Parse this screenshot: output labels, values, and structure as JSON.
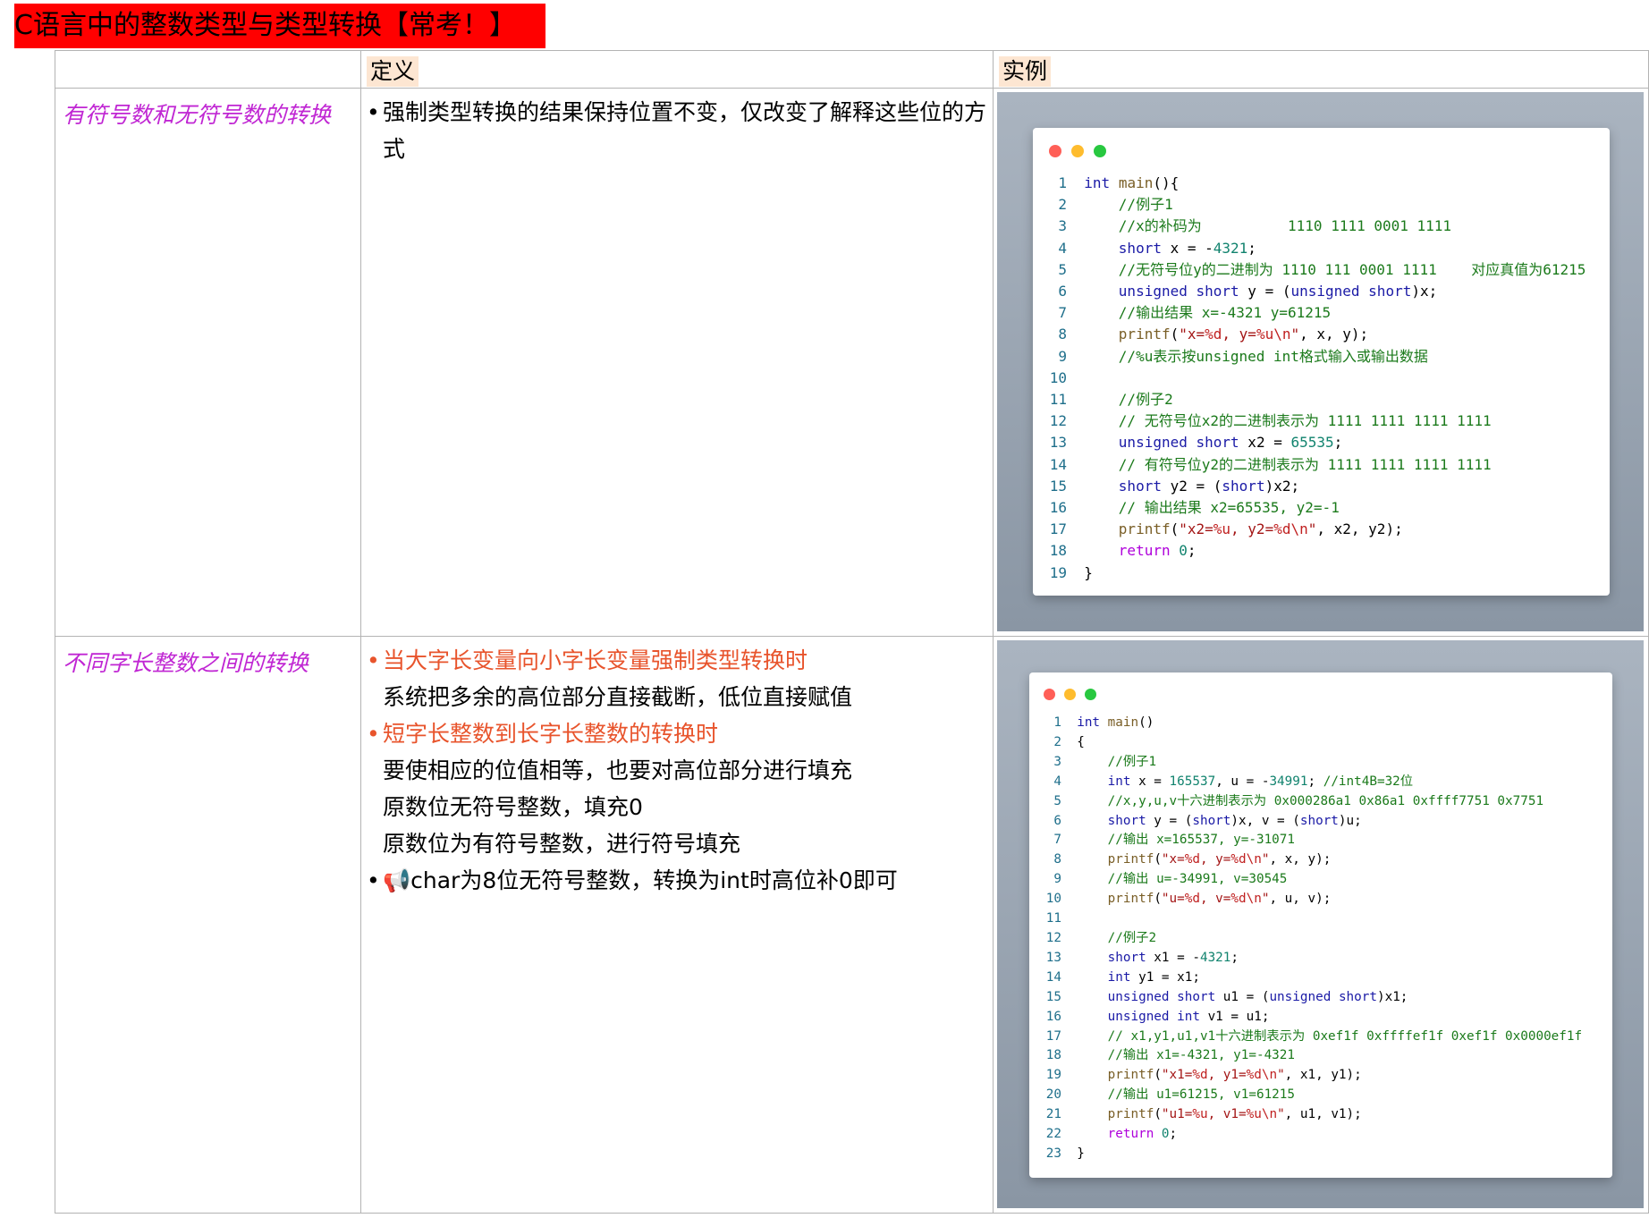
{
  "title": "C语言中的整数类型与类型转换【常考！】",
  "table": {
    "headers": [
      "",
      "定义",
      "实例"
    ],
    "rows": [
      {
        "label": "有符号数和无符号数的转换",
        "definition": [
          {
            "text": "强制类型转换的结果保持位置不变，仅改变了解释这些位的方式",
            "bullet": true,
            "color": "#000000"
          }
        ],
        "code_lines": [
          "int main(){",
          "    //例子1",
          "    //x的补码为          1110 1111 0001 1111",
          "    short x = -4321;",
          "    //无符号位y的二进制为 1110 111 0001 1111    对应真值为61215",
          "    unsigned short y = (unsigned short)x;",
          "    //输出结果 x=-4321 y=61215",
          "    printf(\"x=%d, y=%u\\n\", x, y);",
          "    //%u表示按unsigned int格式输入或输出数据",
          "",
          "    //例子2",
          "    // 无符号位x2的二进制表示为 1111 1111 1111 1111",
          "    unsigned short x2 = 65535;",
          "    // 有符号位y2的二进制表示为 1111 1111 1111 1111",
          "    short y2 = (short)x2;",
          "    // 输出结果 x2=65535, y2=-1",
          "    printf(\"x2=%u, y2=%d\\n\", x2, y2);",
          "    return 0;",
          "}"
        ]
      },
      {
        "label": "不同字长整数之间的转换",
        "definition": [
          {
            "text": "当大字长变量向小字长变量强制类型转换时",
            "bullet": true,
            "color": "#e8542c"
          },
          {
            "text": "系统把多余的高位部分直接截断，低位直接赋值",
            "bullet": false,
            "color": "#000000"
          },
          {
            "text": "短字长整数到长字长整数的转换时",
            "bullet": true,
            "color": "#e8542c"
          },
          {
            "text": "要使相应的位值相等，也要对高位部分进行填充",
            "bullet": false,
            "color": "#000000"
          },
          {
            "text": "原数位无符号整数，填充0",
            "bullet": false,
            "color": "#000000"
          },
          {
            "text": "原数位为有符号整数，进行符号填充",
            "bullet": false,
            "color": "#000000"
          },
          {
            "text": "📢char为8位无符号整数，转换为int时高位补0即可",
            "bullet": true,
            "color": "#000000"
          }
        ],
        "code_lines": [
          "int main()",
          "{",
          "    //例子1",
          "    int x = 165537, u = -34991; //int4B=32位",
          "    //x,y,u,v十六进制表示为 0x000286a1 0x86a1 0xffff7751 0x7751",
          "    short y = (short)x, v = (short)u;",
          "    //输出 x=165537, y=-31071",
          "    printf(\"x=%d, y=%d\\n\", x, y);",
          "    //输出 u=-34991, v=30545",
          "    printf(\"u=%d, v=%d\\n\", u, v);",
          "",
          "    //例子2",
          "    short x1 = -4321;",
          "    int y1 = x1;",
          "    unsigned short u1 = (unsigned short)x1;",
          "    unsigned int v1 = u1;",
          "    // x1,y1,u1,v1十六进制表示为 0xef1f 0xffffef1f 0xef1f 0x0000ef1f",
          "    //输出 x1=-4321, y1=-4321",
          "    printf(\"x1=%d, y1=%d\\n\", x1, y1);",
          "    //输出 u1=61215, v1=61215",
          "    printf(\"u1=%u, v1=%u\\n\", u1, v1);",
          "    return 0;",
          "}"
        ]
      }
    ]
  },
  "window_dot_colors": [
    "#ff5f57",
    "#febc2e",
    "#28c840"
  ]
}
